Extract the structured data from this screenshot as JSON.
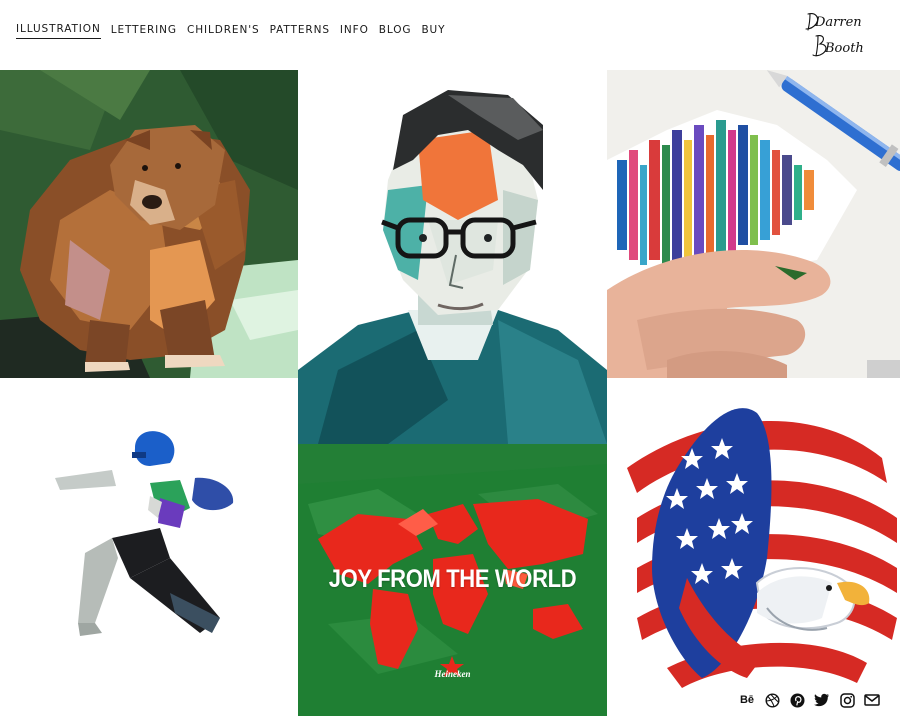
{
  "nav": {
    "items": [
      {
        "label": "ILLUSTRATION",
        "active": true
      },
      {
        "label": "LETTERING",
        "active": false
      },
      {
        "label": "CHILDREN'S",
        "active": false
      },
      {
        "label": "PATTERNS",
        "active": false
      },
      {
        "label": "INFO",
        "active": false
      },
      {
        "label": "BLOG",
        "active": false
      },
      {
        "label": "BUY",
        "active": false
      }
    ]
  },
  "logo": {
    "name": "signature-logo",
    "line1": "Darren",
    "line2": "Booth"
  },
  "gallery": {
    "tiles": [
      {
        "id": "bear",
        "subject": "bear-illustration"
      },
      {
        "id": "portrait",
        "subject": "man-with-glasses-portrait"
      },
      {
        "id": "hand",
        "subject": "collage-with-pen-and-fingers"
      },
      {
        "id": "runner",
        "subject": "football-player-illustration"
      },
      {
        "id": "heineken",
        "subject": "world-map-poster"
      },
      {
        "id": "flag",
        "subject": "eagle-and-flag-illustration"
      }
    ],
    "poster": {
      "headline": "JOY FROM THE WORLD",
      "brand": "Heineken"
    }
  },
  "social": {
    "icons": [
      "behance-icon",
      "dribbble-icon",
      "pinterest-icon",
      "twitter-icon",
      "instagram-icon",
      "email-icon"
    ],
    "behance_text": "Bē"
  },
  "colors": {
    "text": "#1a1a1a",
    "poster_green": "#1d7a31",
    "map_red": "#e3241b",
    "flag_blue": "#1e3f9e",
    "flag_red": "#d62a24"
  }
}
